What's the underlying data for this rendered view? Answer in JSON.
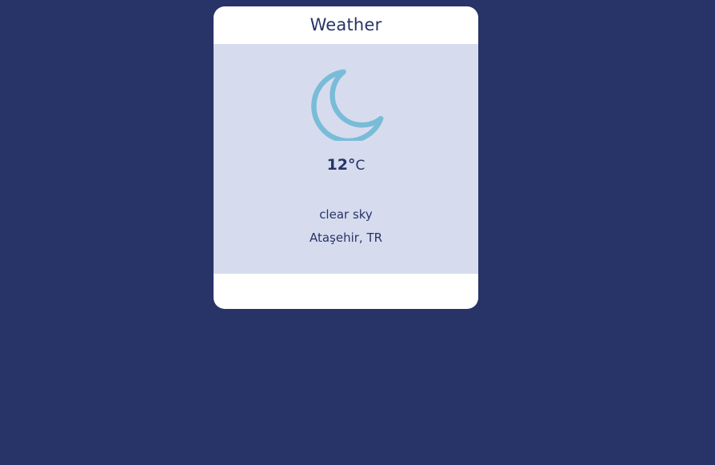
{
  "widget": {
    "title": "Weather",
    "icon": "moon-icon",
    "icon_color": "#7abcd8",
    "temperature": {
      "value": "12°",
      "unit": "C"
    },
    "description": "clear sky",
    "location": "Ataşehir, TR"
  },
  "colors": {
    "background": "#283367",
    "card": "#ffffff",
    "panel": "#d6dcee",
    "text": "#283367"
  }
}
